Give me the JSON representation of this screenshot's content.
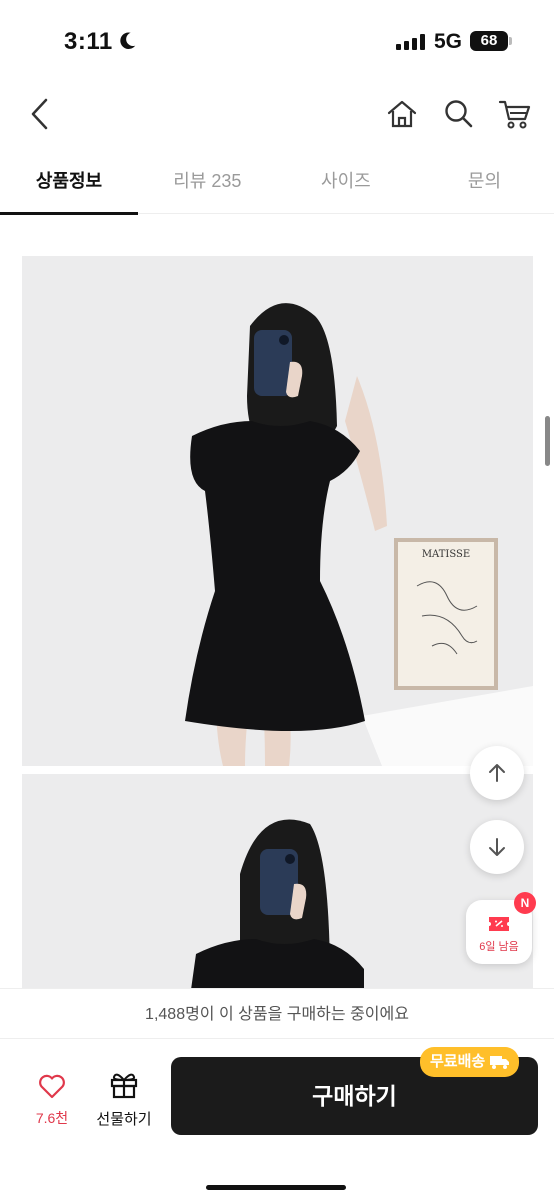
{
  "status_bar": {
    "time": "3:11",
    "network": "5G",
    "battery": "68"
  },
  "header": {
    "back_icon": "chevron-left-icon",
    "home_icon": "home-icon",
    "search_icon": "search-icon",
    "cart_icon": "cart-icon"
  },
  "tabs": [
    {
      "label": "상품정보",
      "active": true
    },
    {
      "label": "리뷰 235",
      "active": false
    },
    {
      "label": "사이즈",
      "active": false
    },
    {
      "label": "문의",
      "active": false
    }
  ],
  "poster": {
    "title": "MATISSE"
  },
  "floating": {
    "coupon_label": "6일 남음",
    "coupon_badge": "N"
  },
  "bottom": {
    "buyers_text": "1,488명이 이 상품을 구매하는 중이에요",
    "like_count": "7.6천",
    "gift_label": "선물하기",
    "buy_label": "구매하기",
    "free_shipping_label": "무료배송"
  },
  "colors": {
    "accent_red": "#e0384b",
    "buy_button": "#1b1b1b",
    "free_ship_badge": "#ffbf2a"
  }
}
